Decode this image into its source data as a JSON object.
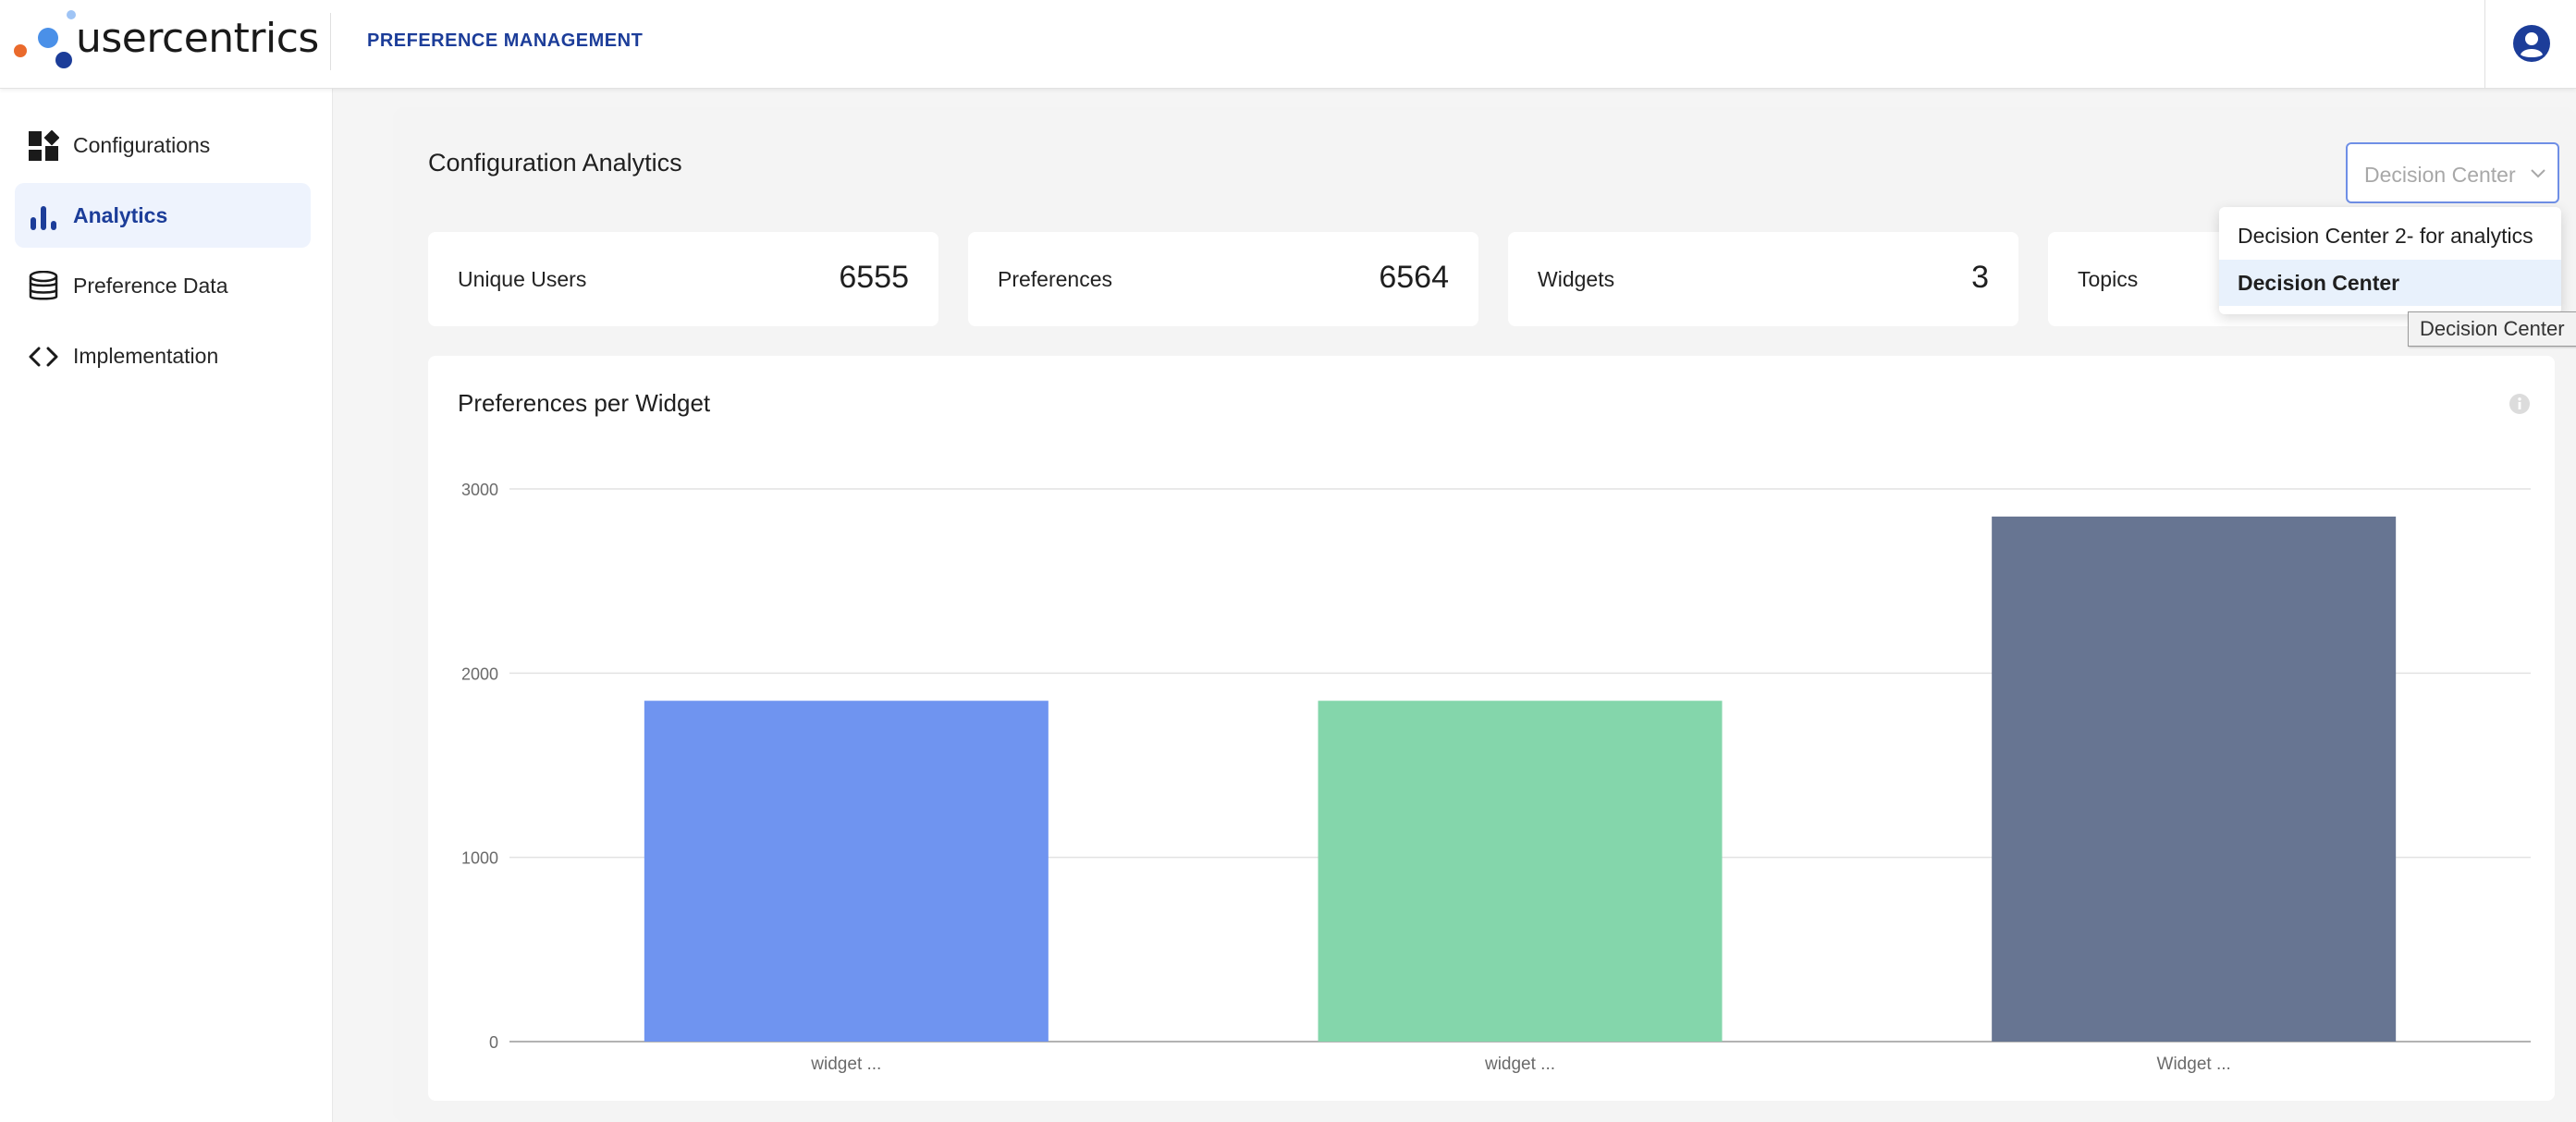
{
  "header": {
    "brand": "usercentrics",
    "title": "PREFERENCE MANAGEMENT"
  },
  "sidebar": {
    "items": [
      {
        "label": "Configurations",
        "icon": "configurations-icon",
        "active": false
      },
      {
        "label": "Analytics",
        "icon": "analytics-icon",
        "active": true
      },
      {
        "label": "Preference Data",
        "icon": "database-icon",
        "active": false
      },
      {
        "label": "Implementation",
        "icon": "code-icon",
        "active": false
      }
    ]
  },
  "main": {
    "title": "Configuration Analytics",
    "select": {
      "value": "Decision Center",
      "options": [
        "Decision Center 2- for analytics",
        "Decision Center"
      ],
      "selected_index": 1,
      "tooltip": "Decision Center"
    },
    "stats": [
      {
        "label": "Unique Users",
        "value": "6555"
      },
      {
        "label": "Preferences",
        "value": "6564"
      },
      {
        "label": "Widgets",
        "value": "3"
      },
      {
        "label": "Topics",
        "value": ""
      }
    ]
  },
  "colors": {
    "accent": "#1c3d99",
    "bar1": "#6f94f0",
    "bar2": "#84d6ab",
    "bar3": "#677592"
  },
  "chart_data": {
    "type": "bar",
    "title": "Preferences per Widget",
    "categories": [
      "widget ...",
      "widget ...",
      "Widget ..."
    ],
    "values": [
      1850,
      1850,
      2850
    ],
    "ylim": [
      0,
      3000
    ],
    "yticks": [
      0,
      1000,
      2000,
      3000
    ],
    "grid": true,
    "xlabel": "",
    "ylabel": ""
  }
}
